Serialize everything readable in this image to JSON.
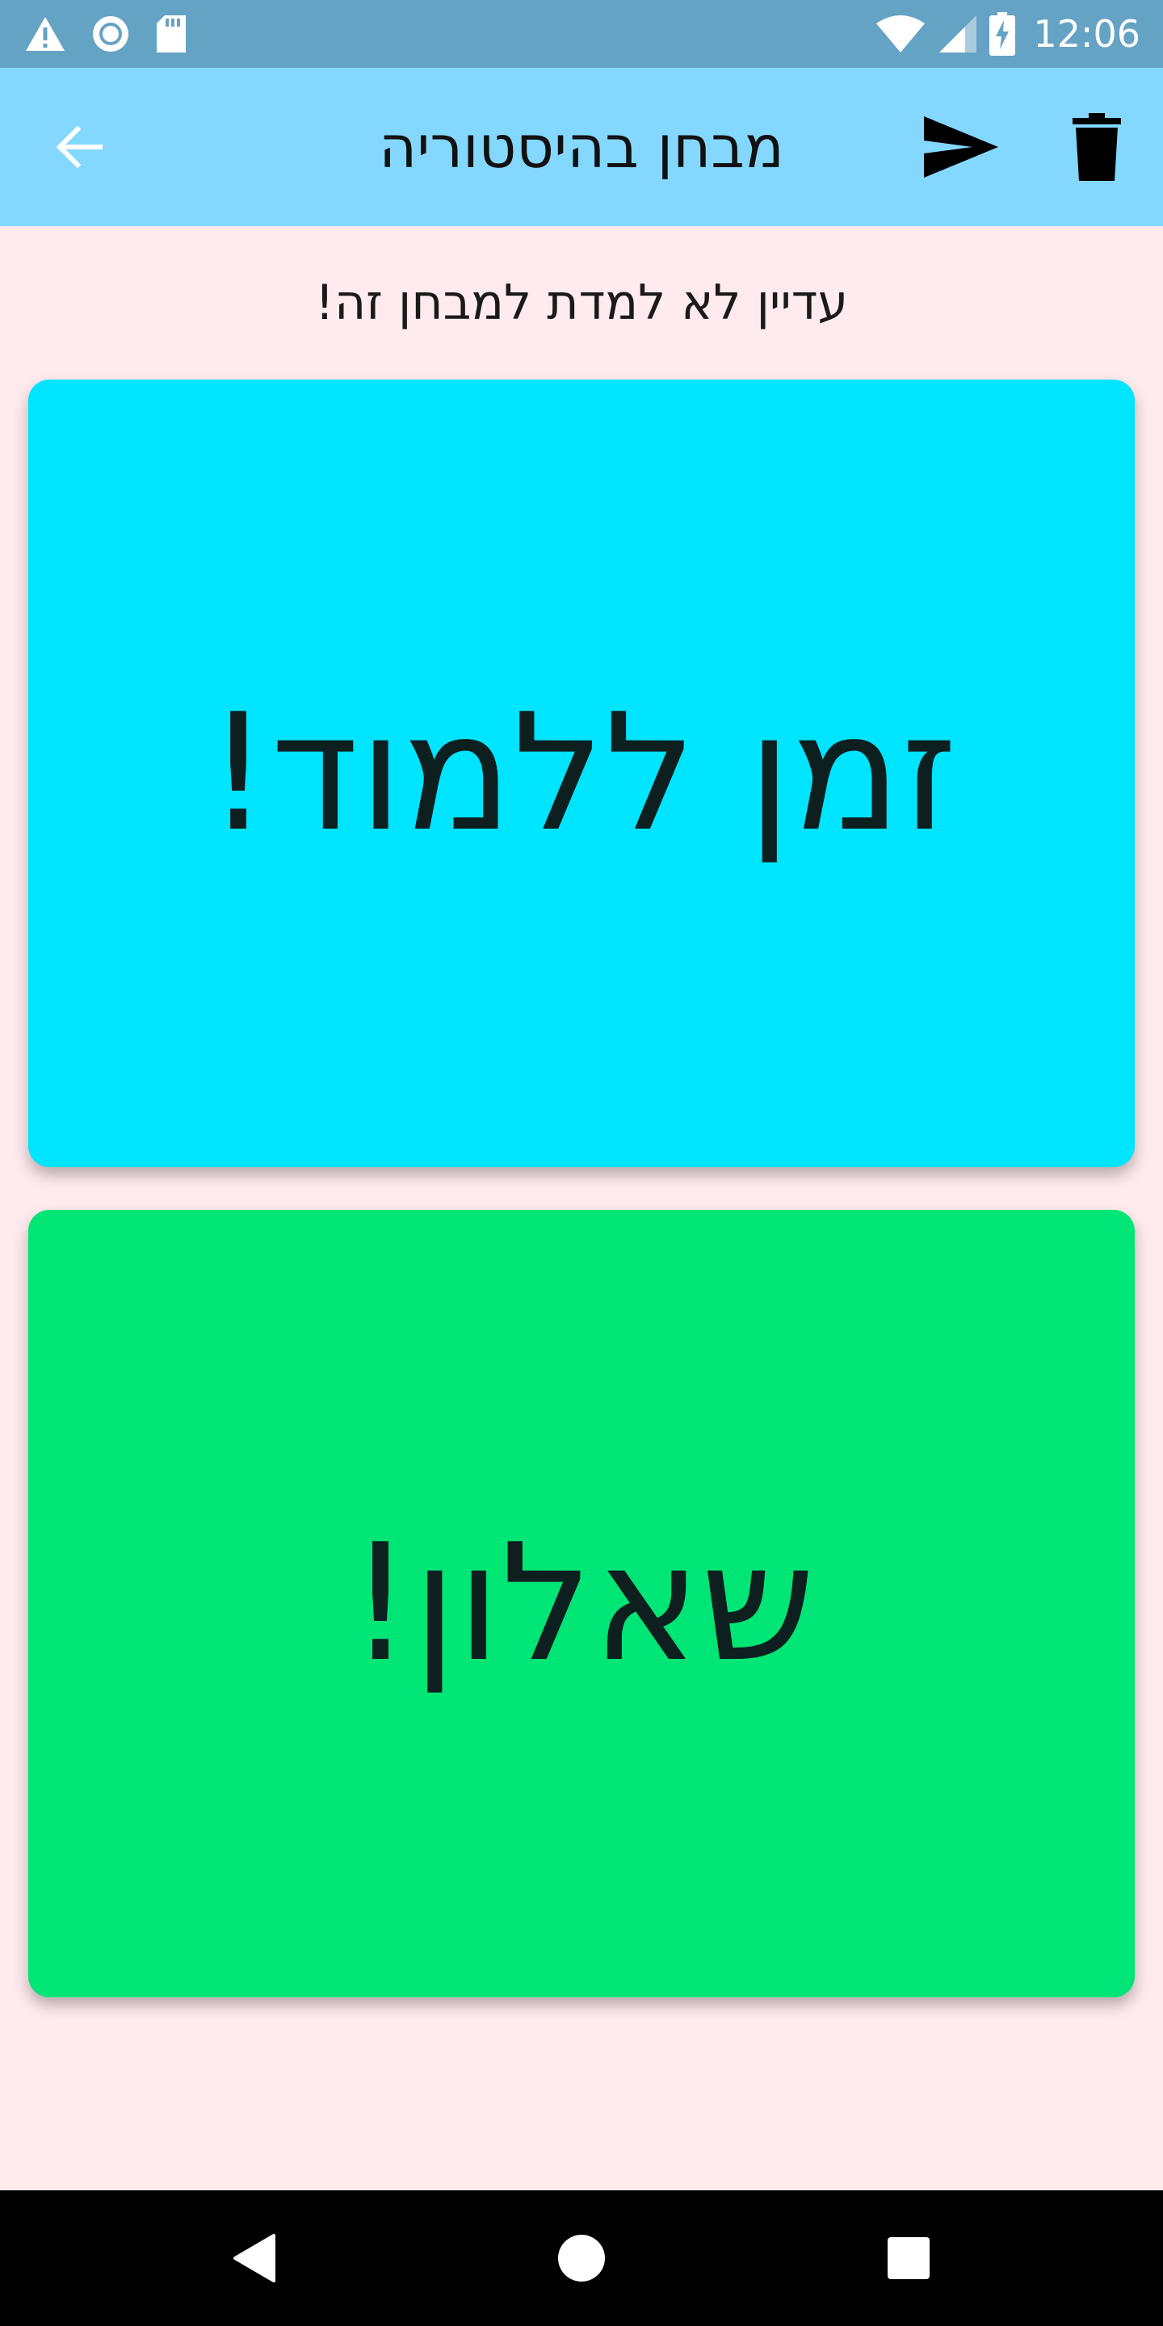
{
  "status_bar": {
    "time": "12:06",
    "left_icons": [
      "warning-icon",
      "sync-circle-icon",
      "sd-card-icon"
    ],
    "right_icons": [
      "wifi-icon",
      "cell-signal-icon",
      "battery-charging-icon"
    ]
  },
  "app_bar": {
    "title": "מבחן בהיסטוריה",
    "back_icon": "arrow-back-icon",
    "send_icon": "send-icon",
    "delete_icon": "trash-icon"
  },
  "subtitle": "עדיין לא למדת למבחן זה!",
  "cards": {
    "study": {
      "label": "זמן ללמוד!",
      "color": "#00E5FF"
    },
    "quiz": {
      "label": "שאלון!",
      "color": "#00E676"
    }
  },
  "colors": {
    "status_bar": "#65A3C4",
    "app_bar": "#84D8FF",
    "background": "#FFEBEE"
  },
  "nav_bar": {
    "icons": [
      "nav-back-icon",
      "nav-home-icon",
      "nav-recents-icon"
    ]
  }
}
